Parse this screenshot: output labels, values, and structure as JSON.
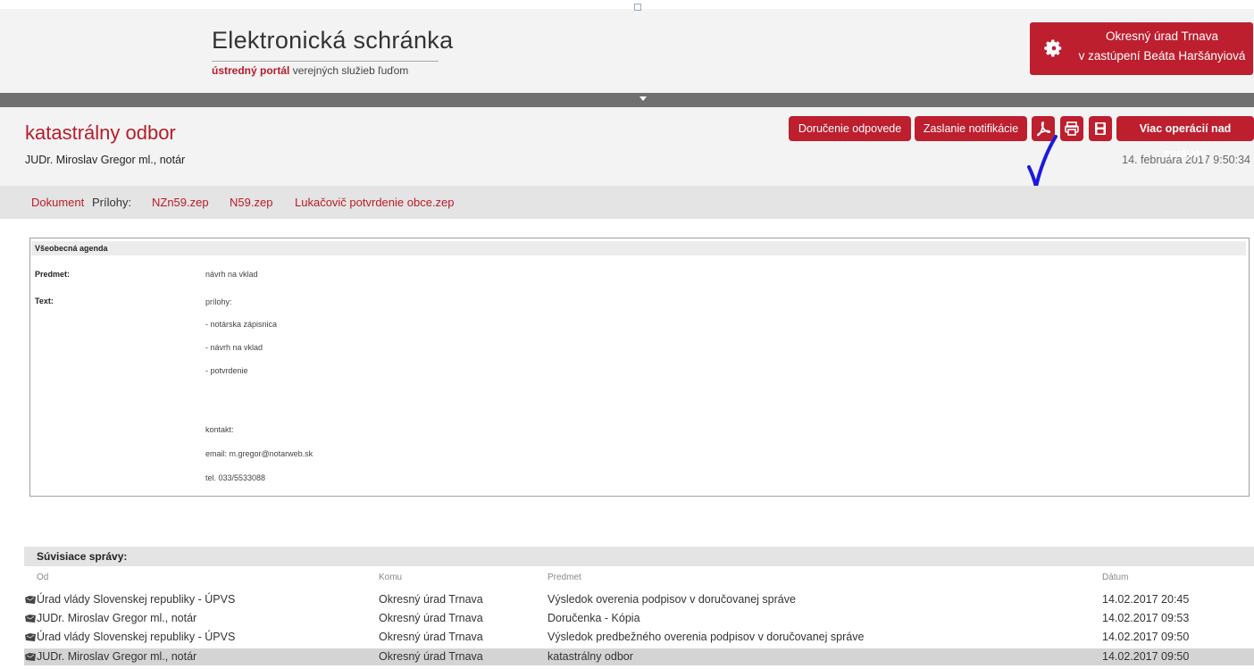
{
  "header": {
    "logo_title": "Elektronická schránka",
    "logo_sub_red": "ústredný portál",
    "logo_sub_rest": "verejných služieb ľuďom",
    "user_name": "Okresný úrad Trnava",
    "user_role": "v zastúpení Beáta Haršányiová"
  },
  "message": {
    "title": "katastrálny odbor",
    "sender": "JUDr. Miroslav Gregor ml., notár",
    "date": "14. februára 2017 9:50:34"
  },
  "toolbar": {
    "delivery_label": "Doručenie odpovede",
    "notify_label": "Zaslanie notifikácie",
    "more_label": "Viac operácií nad správou"
  },
  "attachments": {
    "document_label": "Dokument",
    "attachments_label": "Prílohy:",
    "files": [
      "NZn59.zep",
      "N59.zep",
      "Lukačovič potvrdenie obce.zep"
    ]
  },
  "document": {
    "section_title": "Všeobecná agenda",
    "subject_label": "Predmet:",
    "subject_value": "návrh na vklad",
    "text_label": "Text:",
    "text_lines": [
      "prílohy:",
      "- notárska zápisnica",
      "- návrh na vklad",
      "- potvrdenie",
      "kontakt:",
      "email: m.gregor@notarweb.sk",
      "tel. 033/5533088"
    ]
  },
  "related": {
    "title": "Súvisiace správy:",
    "columns": [
      "Od",
      "Komu",
      "Predmet",
      "Dátum"
    ],
    "rows": [
      {
        "from": "Úrad vlády Slovenskej republiky - ÚPVS",
        "to": "Okresný úrad Trnava",
        "subject": "Výsledok overenia podpisov v doručovanej správe",
        "date": "14.02.2017 20:45"
      },
      {
        "from": "JUDr. Miroslav Gregor ml., notár",
        "to": "Okresný úrad Trnava",
        "subject": "Doručenka - Kópia",
        "date": "14.02.2017 09:53"
      },
      {
        "from": "Úrad vlády Slovenskej republiky - ÚPVS",
        "to": "Okresný úrad Trnava",
        "subject": "Výsledok predbežného overenia podpisov v doručovanej správe",
        "date": "14.02.2017 09:50"
      },
      {
        "from": "JUDr. Miroslav Gregor ml., notár",
        "to": "Okresný úrad Trnava",
        "subject": "katastrálny odbor",
        "date": "14.02.2017 09:50"
      }
    ]
  },
  "colors": {
    "brand_red": "#bd1f2e",
    "header_bg": "#f3f3f3",
    "bar_gray": "#707070",
    "checkmark_blue": "#1a1ae0"
  },
  "icons": [
    "gear-icon",
    "pdf-icon",
    "print-icon",
    "save-icon",
    "envelope-icon",
    "checkmark-annotation"
  ]
}
